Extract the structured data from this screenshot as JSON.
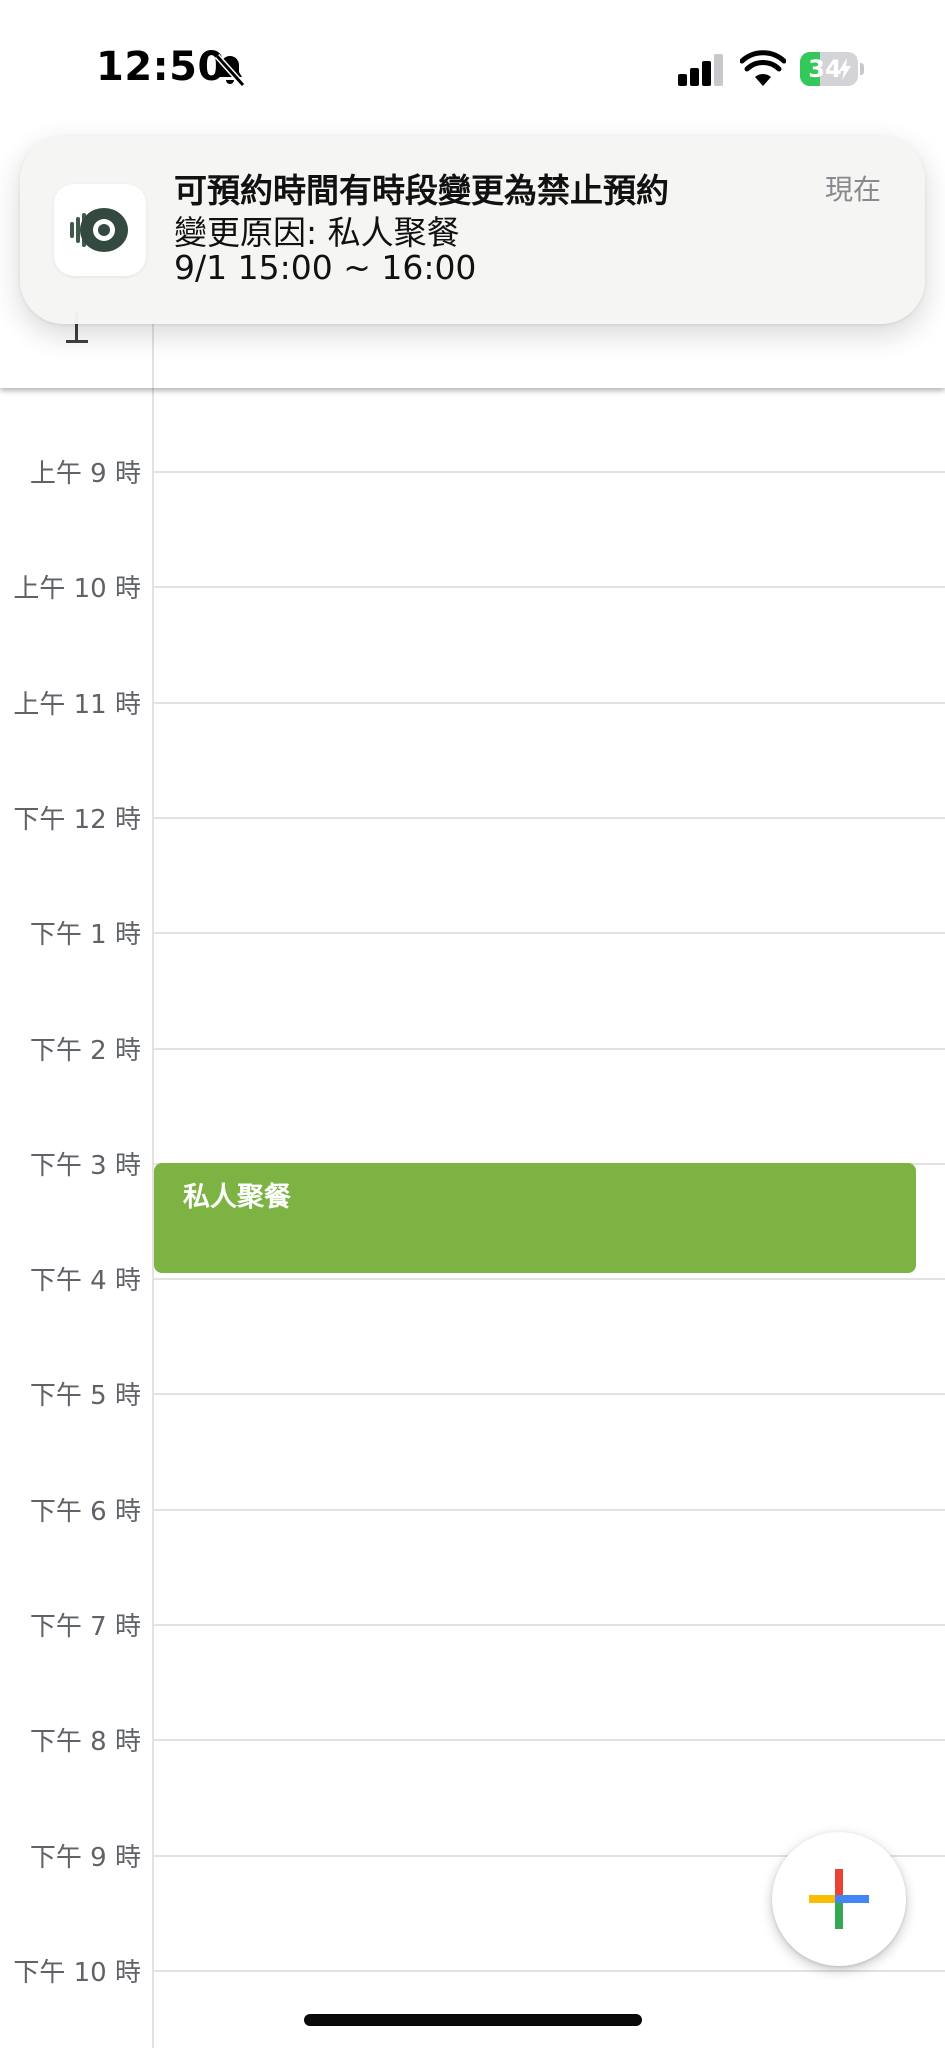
{
  "status_bar": {
    "time": "12:50",
    "battery": "34",
    "battery_level_percent": 34,
    "icons": [
      "bell-slash-icon",
      "cellular-signal-icon",
      "wifi-icon",
      "battery-charging-icon"
    ]
  },
  "notification": {
    "app_icon": "app-logo-icon",
    "title": "可預約時間有時段變更為禁止預約",
    "line1": "變更原因: 私人聚餐",
    "line2": "9/1 15:00 ~ 16:00",
    "time": "現在"
  },
  "timeline": {
    "hours": [
      "上午 9 時",
      "上午 10 時",
      "上午 11 時",
      "下午 12 時",
      "下午 1 時",
      "下午 2 時",
      "下午 3 時",
      "下午 4 時",
      "下午 5 時",
      "下午 6 時",
      "下午 7 時",
      "下午 8 時",
      "下午 9 時",
      "下午 10 時"
    ]
  },
  "event": {
    "title": "私人聚餐",
    "color": "#7cb342"
  },
  "fab": {
    "icon": "plus-icon",
    "colors": [
      "#ea4335",
      "#fbbc04",
      "#34a853",
      "#4285f4"
    ]
  }
}
